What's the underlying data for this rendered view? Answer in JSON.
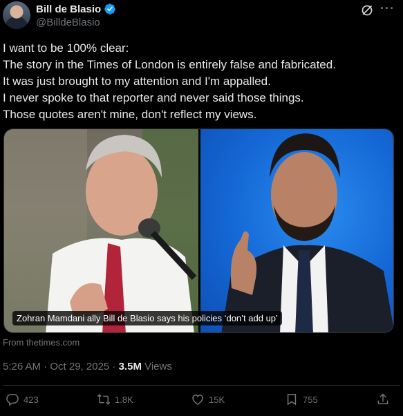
{
  "author": {
    "name": "Bill de Blasio",
    "handle": "@BilldeBlasio"
  },
  "tweet": {
    "lines": [
      "I want to be 100% clear:",
      "The story in the Times of London is entirely false and fabricated.",
      "It was just brought to my attention and I'm appalled.",
      "I never spoke to that reporter and never said those things.",
      "Those quotes aren't mine, don't reflect my views."
    ]
  },
  "card": {
    "caption": "Zohran Mamdani ally Bill de Blasio says his policies ‘don’t add up’",
    "source": "From thetimes.com"
  },
  "meta": {
    "timestamp": "5:26 AM · Oct 29, 2025 · ",
    "views_count": "3.5M",
    "views_label": " Views"
  },
  "actions": {
    "replies": "423",
    "reposts": "1.8K",
    "likes": "15K",
    "bookmarks": "755"
  },
  "colors": {
    "background": "#000000",
    "text": "#e7e9ea",
    "secondary": "#71767b",
    "verified": "#1d9bf0"
  },
  "icons": [
    "grok-icon",
    "more-icon",
    "verified-icon",
    "reply-icon",
    "repost-icon",
    "like-icon",
    "bookmark-icon",
    "share-icon"
  ]
}
